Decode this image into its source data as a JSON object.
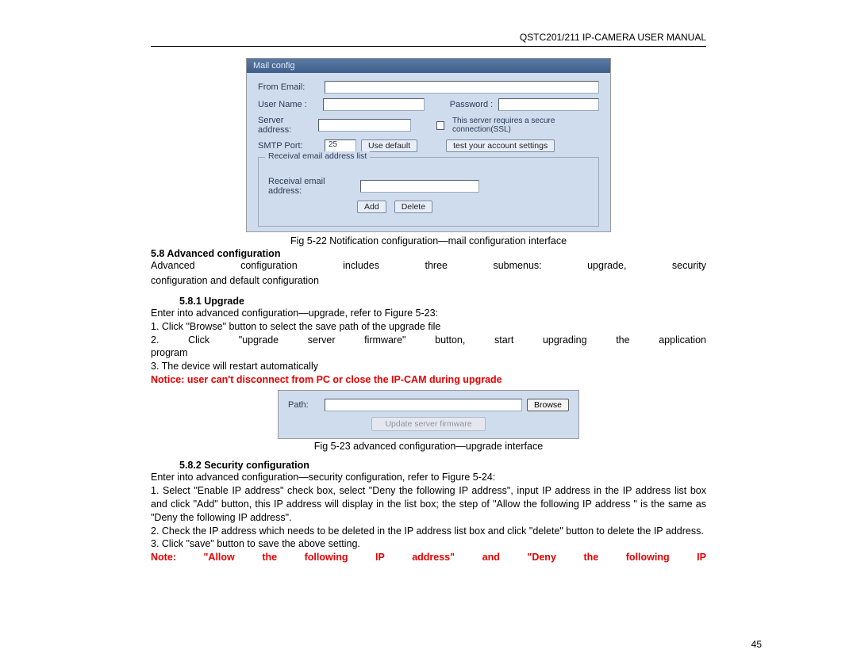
{
  "doc_header": "QSTC201/211 IP-CAMERA USER MANUAL",
  "page_number": "45",
  "fig_mail": {
    "titlebar": "Mail config",
    "from_email_label": "From Email:",
    "user_name_label": "User Name :",
    "password_label": "Password :",
    "server_address_label": "Server address:",
    "ssl_label": "This server requires a secure connection(SSL)",
    "smtp_port_label": "SMTP Port:",
    "smtp_port_value": "25",
    "use_default_btn": "Use default",
    "test_btn": "test your account settings",
    "fieldset_legend": "Receival email address list",
    "receival_label": "Receival email address:",
    "add_btn": "Add",
    "delete_btn": "Delete"
  },
  "caption_mail": "Fig 5-22 Notification configuration—mail configuration interface",
  "section_5_8": "5.8  Advanced configuration",
  "para_5_8": "Advanced configuration includes three submenus: upgrade, security configuration and default configuration",
  "section_5_8_1": "5.8.1  Upgrade",
  "upgrade_intro": "Enter into advanced configuration—upgrade, refer to Figure 5-23:",
  "upgrade_step1": "1. Click \"Browse\" button to select the save path of the upgrade file",
  "upgrade_step2": "2. Click \"upgrade server firmware\" button, start upgrading the application program",
  "upgrade_step3": "3. The device will restart automatically",
  "upgrade_notice": "Notice: user can't disconnect from PC or close the IP-CAM during upgrade",
  "fig_upgrade": {
    "path_label": "Path:",
    "browse_btn": "Browse",
    "update_btn": "Update server firmware"
  },
  "caption_upgrade": "Fig 5-23 advanced configuration—upgrade interface",
  "section_5_8_2": "5.8.2  Security configuration",
  "sec_intro": "Enter into advanced configuration—security configuration, refer to Figure 5-24:",
  "sec_step1": "1. Select \"Enable IP address\" check box, select \"Deny the following IP address\", input IP address in the IP address list box and click \"Add\" button, this IP address will display in the list box; the step of \"Allow the following IP address \" is the same as \"Deny the following IP address\".",
  "sec_step2": "2. Check the IP address which needs to be deleted in the IP address list box and click \"delete\" button to delete the IP address.",
  "sec_step3": "3. Click \"save\" button to save the above setting.",
  "sec_note": "Note: \"Allow the following IP address\" and \"Deny the following IP"
}
